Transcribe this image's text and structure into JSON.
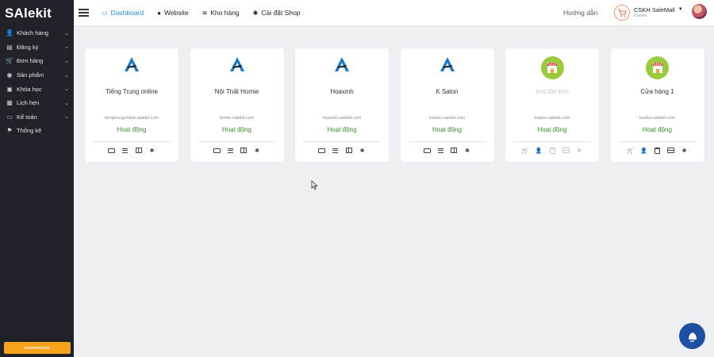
{
  "brand": {
    "logo_text_a": "S",
    "logo_text_b": "A",
    "logo_text_c": "lekit"
  },
  "sidebar": {
    "items": [
      {
        "label": "Khách hàng",
        "icon": "user-icon",
        "has_submenu": true
      },
      {
        "label": "Đăng ký",
        "icon": "register-icon",
        "has_submenu": true
      },
      {
        "label": "Đơn hàng",
        "icon": "cart-icon",
        "has_submenu": true
      },
      {
        "label": "Sản phẩm",
        "icon": "product-icon",
        "has_submenu": true
      },
      {
        "label": "Khóa học",
        "icon": "course-icon",
        "has_submenu": true
      },
      {
        "label": "Lịch hẹn",
        "icon": "calendar-icon",
        "has_submenu": true
      },
      {
        "label": "Kế toán",
        "icon": "accounting-icon",
        "has_submenu": true
      },
      {
        "label": "Thống kê",
        "icon": "flag-icon",
        "has_submenu": false
      }
    ],
    "enterprise_label": "ENTERPRISE"
  },
  "topbar": {
    "nav": [
      {
        "label": "Dashboard",
        "icon": "monitor-icon",
        "active": true
      },
      {
        "label": "Website",
        "icon": "globe-icon",
        "active": false
      },
      {
        "label": "Kho hàng",
        "icon": "layers-icon",
        "active": false
      },
      {
        "label": "Cài đặt Shop",
        "icon": "gear-icon",
        "active": false
      }
    ],
    "guide_label": "Hướng dẫn",
    "account": {
      "name": "CSKH SaleMall",
      "role": "Owner"
    }
  },
  "shops": [
    {
      "name": "Tiếng Trung online",
      "domain": "tiengtrungonline.salekit.com",
      "status": "Hoạt động",
      "logo": "salekit-logo-icon",
      "type": "site",
      "muted": false
    },
    {
      "name": "Nội Thất Homie",
      "domain": "homie.salekit.com",
      "status": "Hoạt động",
      "logo": "salekit-logo-icon",
      "type": "site",
      "muted": false
    },
    {
      "name": "Hoaxinh",
      "domain": "hoaxinh.salekit.com",
      "status": "Hoạt động",
      "logo": "salekit-logo-icon",
      "type": "site",
      "muted": false
    },
    {
      "name": "K Salon",
      "domain": "ksalon.salekit.com",
      "status": "Hoạt động",
      "logo": "salekit-logo-icon",
      "type": "site",
      "muted": false
    },
    {
      "name": "test tồn kho",
      "domain": "ksalon.salekit.com",
      "status": "Hoạt động",
      "logo": "store-icon",
      "type": "store",
      "muted": true
    },
    {
      "name": "Cửa hàng 1",
      "domain": "ksalon.salekit.com",
      "status": "Hoạt động",
      "logo": "store-icon",
      "type": "store",
      "muted": false
    }
  ],
  "colors": {
    "sidebar_bg": "#1f2329",
    "accent": "#2a8bd6",
    "status_green": "#3b8b2f",
    "enterprise": "#f6a21a",
    "chat": "#1f4fa0"
  }
}
